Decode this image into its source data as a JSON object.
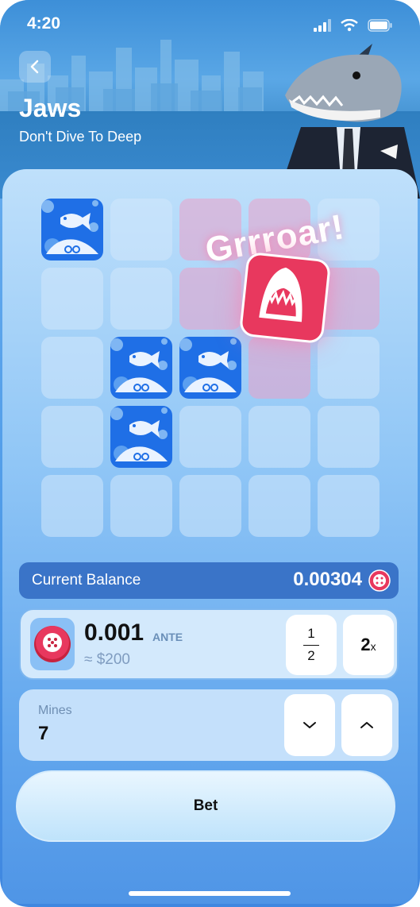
{
  "status_bar": {
    "time": "4:20",
    "icons": [
      "signal-icon",
      "wifi-icon",
      "battery-icon"
    ]
  },
  "header": {
    "title": "Jaws",
    "subtitle": "Don't Dive To Deep",
    "back_icon": "chevron-left-icon"
  },
  "board": {
    "rows": 5,
    "cols": 5,
    "tiles": [
      [
        "fish",
        "hidden",
        "danger",
        "danger",
        "hidden"
      ],
      [
        "hidden",
        "hidden",
        "danger",
        "danger",
        "danger"
      ],
      [
        "hidden",
        "fish",
        "fish",
        "danger",
        "hidden"
      ],
      [
        "hidden",
        "fish",
        "hidden",
        "hidden",
        "hidden"
      ],
      [
        "hidden",
        "hidden",
        "hidden",
        "hidden",
        "hidden"
      ]
    ],
    "reveal_text": "Grrroar!",
    "reveal_icon": "shark-mouth-icon"
  },
  "balance": {
    "label": "Current Balance",
    "value": "0.00304",
    "currency_icon": "chip-icon"
  },
  "bet": {
    "amount": "0.001",
    "unit": "ANTE",
    "usd": "≈ $200",
    "half_top": "1",
    "half_bottom": "2",
    "double_value": "2",
    "double_suffix": "x"
  },
  "mines": {
    "label": "Mines",
    "value": "7",
    "down_icon": "chevron-down-icon",
    "up_icon": "chevron-up-icon"
  },
  "action": {
    "bet_label": "Bet"
  },
  "colors": {
    "accent": "#1f6fe6",
    "danger": "#e8385e",
    "panel": "#bfe0fb"
  }
}
